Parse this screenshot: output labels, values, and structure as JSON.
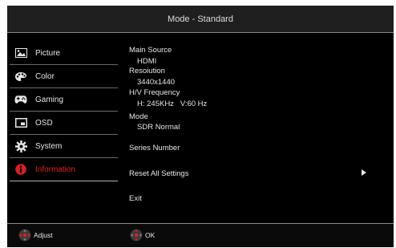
{
  "title": "Mode - Standard",
  "menu": [
    {
      "label": "Picture",
      "icon": "picture-icon"
    },
    {
      "label": "Color",
      "icon": "palette-icon"
    },
    {
      "label": "Gaming",
      "icon": "gamepad-icon"
    },
    {
      "label": "OSD",
      "icon": "osd-icon"
    },
    {
      "label": "System",
      "icon": "gear-icon"
    },
    {
      "label": "Information",
      "icon": "info-icon",
      "active": true
    }
  ],
  "info": {
    "main_source_label": "Main Source",
    "main_source_value": "HDMI",
    "resolution_label": "Resoiution",
    "resolution_value": "3440x1440",
    "hv_label": "H/V Frequency",
    "hv_value": "H: 245KHz   V:60 Hz",
    "mode_label": "Mode",
    "mode_value": "SDR Normal",
    "series_label": "Series Number",
    "reset_label": "Reset All Settings",
    "exit_label": "Exit"
  },
  "footer": {
    "adjust_label": "Adjust",
    "ok_label": "OK"
  },
  "colors": {
    "accent": "#d22222",
    "background": "#000000",
    "text": "#e6e6e6"
  }
}
